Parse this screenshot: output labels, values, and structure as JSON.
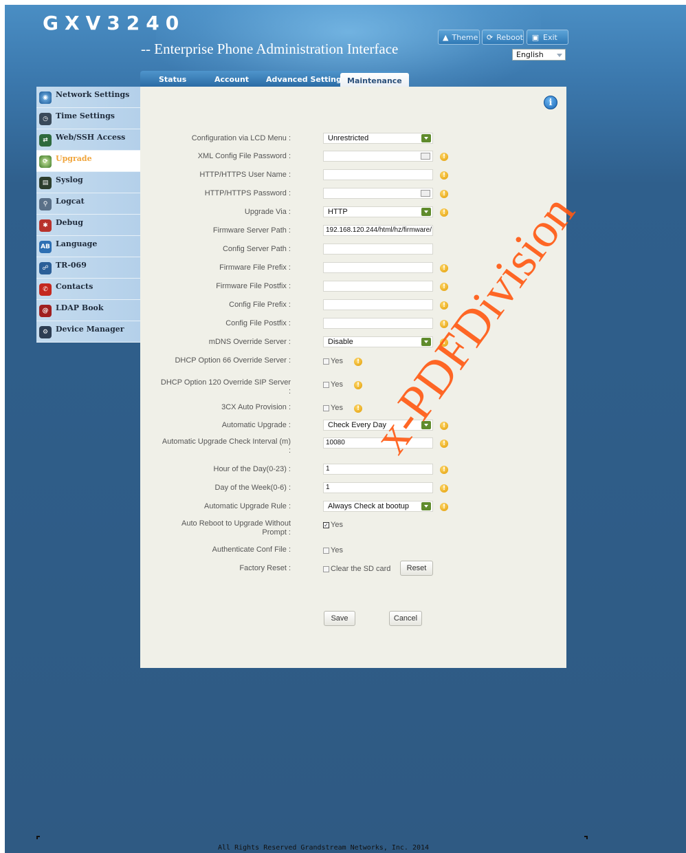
{
  "header": {
    "title": "GXV3240",
    "subtitle": "-- Enterprise Phone Administration Interface",
    "buttons": [
      {
        "label": "Theme",
        "icon": "tshirt-icon"
      },
      {
        "label": "Reboot",
        "icon": "refresh-icon"
      },
      {
        "label": "Exit",
        "icon": "exit-icon"
      }
    ],
    "language": "English"
  },
  "tabs": [
    {
      "label": "Status"
    },
    {
      "label": "Account"
    },
    {
      "label": "Advanced Settings"
    },
    {
      "label": "Maintenance",
      "active": true
    }
  ],
  "sidebar": {
    "items": [
      {
        "label": "Network Settings",
        "icon": "network-settings-icon"
      },
      {
        "label": "Time Settings",
        "icon": "time-settings-icon"
      },
      {
        "label": "Web/SSH Access",
        "icon": "web-ssh-icon"
      },
      {
        "label": "Upgrade",
        "icon": "upgrade-icon",
        "active": true
      },
      {
        "label": "Syslog",
        "icon": "syslog-icon"
      },
      {
        "label": "Logcat",
        "icon": "logcat-icon"
      },
      {
        "label": "Debug",
        "icon": "debug-icon"
      },
      {
        "label": "Language",
        "icon": "language-icon"
      },
      {
        "label": "TR-069",
        "icon": "tr069-icon"
      },
      {
        "label": "Contacts",
        "icon": "contacts-icon"
      },
      {
        "label": "LDAP Book",
        "icon": "ldap-book-icon"
      },
      {
        "label": "Device Manager",
        "icon": "device-manager-icon"
      }
    ]
  },
  "form": {
    "lcd_menu": {
      "label": "Configuration via LCD Menu :",
      "value": "Unrestricted"
    },
    "xml_password": {
      "label": "XML Config File Password :",
      "value": ""
    },
    "http_user": {
      "label": "HTTP/HTTPS User Name :",
      "value": ""
    },
    "http_password": {
      "label": "HTTP/HTTPS Password :",
      "value": ""
    },
    "upgrade_via": {
      "label": "Upgrade Via :",
      "value": "HTTP"
    },
    "fw_server_path": {
      "label": "Firmware Server Path :",
      "value": "192.168.120.244/html/hz/firmware/"
    },
    "config_server_path": {
      "label": "Config Server Path :",
      "value": ""
    },
    "fw_prefix": {
      "label": "Firmware File Prefix :",
      "value": ""
    },
    "fw_postfix": {
      "label": "Firmware File Postfix :",
      "value": ""
    },
    "cfg_prefix": {
      "label": "Config File Prefix :",
      "value": ""
    },
    "cfg_postfix": {
      "label": "Config File Postfix :",
      "value": ""
    },
    "mdns_override": {
      "label": "mDNS Override Server :",
      "value": "Disable"
    },
    "dhcp66": {
      "label": "DHCP Option 66 Override Server :",
      "checkbox": "Yes",
      "checked": false
    },
    "dhcp120": {
      "label": "DHCP Option 120 Override SIP Server :",
      "checkbox": "Yes",
      "checked": false
    },
    "cx3_auto": {
      "label": "3CX Auto Provision :",
      "checkbox": "Yes",
      "checked": false
    },
    "auto_upgrade": {
      "label": "Automatic Upgrade :",
      "value": "Check Every Day"
    },
    "check_interval": {
      "label": "Automatic Upgrade Check Interval (m) :",
      "value": "10080"
    },
    "hour_of_day": {
      "label": "Hour of the Day(0-23) :",
      "value": "1"
    },
    "day_of_week": {
      "label": "Day of the Week(0-6) :",
      "value": "1"
    },
    "upgrade_rule": {
      "label": "Automatic Upgrade Rule :",
      "value": "Always Check at bootup"
    },
    "auto_reboot": {
      "label": "Auto Reboot to Upgrade Without Prompt :",
      "checkbox": "Yes",
      "checked": true
    },
    "auth_conf": {
      "label": "Authenticate Conf File :",
      "checkbox": "Yes",
      "checked": false
    },
    "factory_reset": {
      "label": "Factory Reset :",
      "checkbox": "Clear the SD card",
      "checked": false,
      "button": "Reset"
    },
    "save_label": "Save",
    "cancel_label": "Cancel"
  },
  "watermark": "x-PDFDivision",
  "footer": "All Rights Reserved Grandstream Networks, Inc. 2014"
}
